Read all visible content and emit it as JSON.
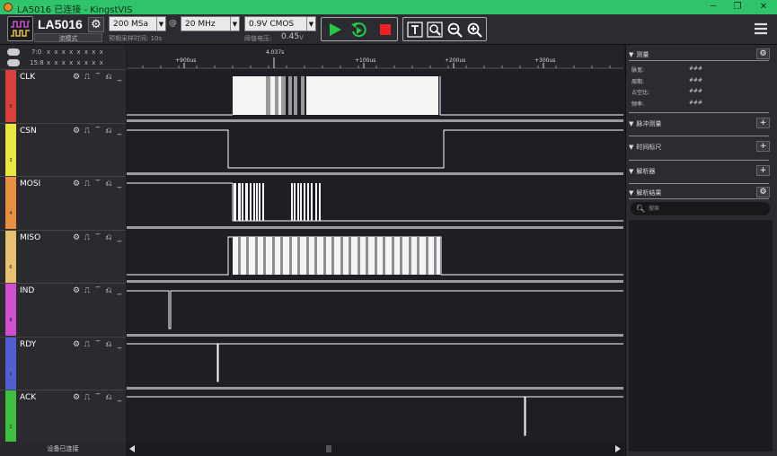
{
  "window": {
    "title": "LA5016 已连接 - KingstVIS",
    "controls": [
      "─",
      "❐",
      "✕"
    ]
  },
  "device": {
    "name": "LA5016",
    "mode": "流模式"
  },
  "toolbar": {
    "sample_rate": "200 MSa",
    "at_sign": "@",
    "sample_freq": "20 MHz",
    "threshold_type": "0.9V CMOS",
    "expected_time_label": "预期采样时间: 10s",
    "threshold_label": "阈值电压:",
    "threshold_value": "0.45",
    "threshold_unit": "V"
  },
  "global_channels": [
    {
      "label": "7:0",
      "values": "x x x x x x x x"
    },
    {
      "label": "15:8",
      "values": "x x x x x x x x"
    }
  ],
  "channels": [
    {
      "name": "CLK",
      "number": "5",
      "color": "#d9403a"
    },
    {
      "name": "CSN",
      "number": "3",
      "color": "#e8e840"
    },
    {
      "name": "MOSI",
      "number": "4",
      "color": "#e89040"
    },
    {
      "name": "MISO",
      "number": "6",
      "color": "#e8c070"
    },
    {
      "name": "IND",
      "number": "8",
      "color": "#d050d0"
    },
    {
      "name": "RDY",
      "number": "1",
      "color": "#5060d0"
    },
    {
      "name": "ACK",
      "number": "2",
      "color": "#40c040"
    }
  ],
  "ruler": {
    "cursor_label": "4.037s",
    "ticks": [
      "+900us",
      "+100us",
      "+200us",
      "+300us"
    ]
  },
  "status": "设备已连接",
  "right_panel": {
    "measure": {
      "title": "测量",
      "rows": [
        {
          "label": "脉宽:",
          "value": "###"
        },
        {
          "label": "周期:",
          "value": "###"
        },
        {
          "label": "占空比:",
          "value": "###"
        },
        {
          "label": "频率:",
          "value": "###"
        }
      ]
    },
    "pulse_measure": "脉冲测量",
    "time_ruler": "时间标尺",
    "analyzer": "解析器",
    "results": "解析结果",
    "search_placeholder": "搜索"
  }
}
